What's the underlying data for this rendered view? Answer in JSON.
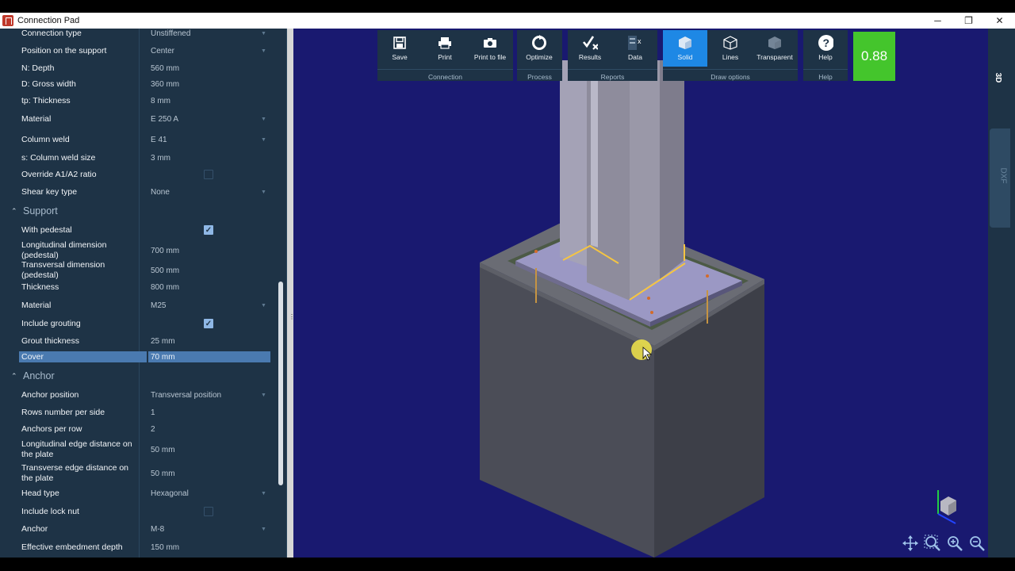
{
  "window": {
    "title": "Connection Pad",
    "minimize": "─",
    "maximize": "❐",
    "close": "✕"
  },
  "panel": {
    "top_rows": [
      {
        "label": "Connection type",
        "value": "Unstiffened",
        "dropdown": true
      },
      {
        "label": "Position on the support",
        "value": "Center",
        "dropdown": true
      },
      {
        "label": "N: Depth",
        "value": "560 mm"
      },
      {
        "label": "D: Gross width",
        "value": "360 mm"
      },
      {
        "label": "tp: Thickness",
        "value": "8 mm"
      },
      {
        "label": "Material",
        "value": "E 250 A",
        "dropdown": true
      },
      {
        "label": "Column weld",
        "value": "E 41",
        "dropdown": true
      },
      {
        "label": "s: Column weld size",
        "value": "3 mm"
      },
      {
        "label": "Override A1/A2 ratio",
        "value": "",
        "checkbox": false
      },
      {
        "label": "Shear key type",
        "value": "None",
        "dropdown": true
      }
    ],
    "support": {
      "title": "Support",
      "rows": [
        {
          "label": "With pedestal",
          "checkbox": true
        },
        {
          "label": "Longitudinal dimension (pedestal)",
          "value": "700 mm"
        },
        {
          "label": "Transversal dimension (pedestal)",
          "value": "500 mm"
        },
        {
          "label": "Thickness",
          "value": "800 mm"
        },
        {
          "label": "Material",
          "value": "M25",
          "dropdown": true
        },
        {
          "label": "Include grouting",
          "checkbox": true
        },
        {
          "label": "Grout thickness",
          "value": "25 mm"
        },
        {
          "label": "Cover",
          "value": "70 mm",
          "selected": true
        }
      ]
    },
    "anchor": {
      "title": "Anchor",
      "rows": [
        {
          "label": "Anchor position",
          "value": "Transversal position",
          "dropdown": true
        },
        {
          "label": "Rows number per side",
          "value": "1"
        },
        {
          "label": "Anchors per row",
          "value": "2"
        },
        {
          "label": "Longitudinal edge distance on the plate",
          "value": "50 mm"
        },
        {
          "label": "Transverse edge distance on the plate",
          "value": "50 mm"
        },
        {
          "label": "Head type",
          "value": "Hexagonal",
          "dropdown": true
        },
        {
          "label": "Include lock nut",
          "value": "",
          "checkbox": false
        },
        {
          "label": "Anchor",
          "value": "M-8",
          "dropdown": true
        },
        {
          "label": "Effective embedment depth",
          "value": "150 mm"
        }
      ]
    }
  },
  "ribbon": {
    "connection": {
      "group": "Connection",
      "save": "Save",
      "print": "Print",
      "print_to_file": "Print to file"
    },
    "process": {
      "group": "Process",
      "optimize": "Optimize"
    },
    "reports": {
      "group": "Reports",
      "results": "Results",
      "data": "Data"
    },
    "draw": {
      "group": "Draw options",
      "solid": "Solid",
      "lines": "Lines",
      "transparent": "Transparent"
    },
    "help": {
      "group": "Help",
      "help": "Help"
    }
  },
  "score": "0.88",
  "side_tabs": {
    "tab_3d": "3D",
    "tab_dxf": "DXF"
  },
  "colors": {
    "panel_bg": "#1e3346",
    "viewport_bg": "#191970",
    "active": "#1e88e5",
    "score_bg": "#44c52c",
    "selection": "#4a7ab0"
  }
}
